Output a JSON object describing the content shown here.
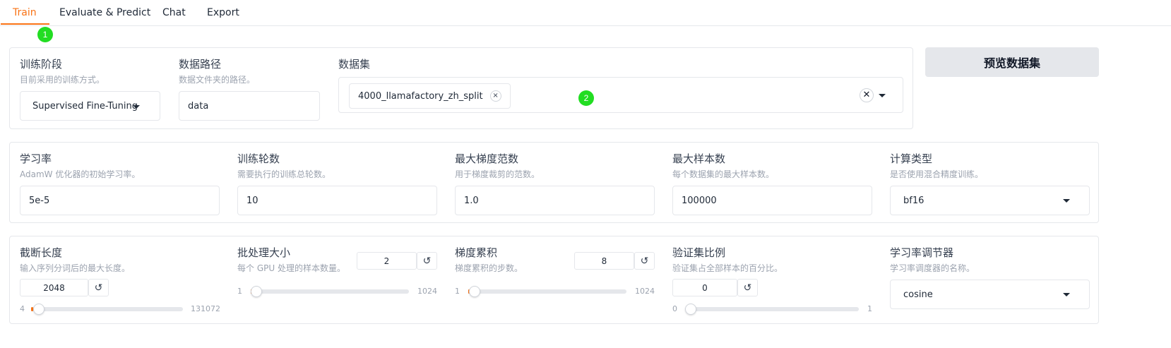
{
  "tabs": [
    {
      "label": "Train",
      "active": true
    },
    {
      "label": "Evaluate & Predict",
      "active": false
    },
    {
      "label": "Chat",
      "active": false
    },
    {
      "label": "Export",
      "active": false
    }
  ],
  "markers": [
    "1",
    "2"
  ],
  "colors": {
    "accent": "#f97316",
    "marker": "#22dd22"
  },
  "row1": {
    "stage": {
      "label": "训练阶段",
      "info": "目前采用的训练方式。",
      "value": "Supervised Fine-Tuning"
    },
    "dataset_dir": {
      "label": "数据路径",
      "info": "数据文件夹的路径。",
      "value": "data"
    },
    "dataset": {
      "label": "数据集",
      "selected": "4000_llamafactory_zh_split",
      "chip_remove": "×",
      "clear": "✕"
    },
    "preview_button": "预览数据集"
  },
  "row2": {
    "learning_rate": {
      "label": "学习率",
      "info": "AdamW 优化器的初始学习率。",
      "value": "5e-5"
    },
    "num_epochs": {
      "label": "训练轮数",
      "info": "需要执行的训练总轮数。",
      "value": "10"
    },
    "max_grad_norm": {
      "label": "最大梯度范数",
      "info": "用于梯度裁剪的范数。",
      "value": "1.0"
    },
    "max_samples": {
      "label": "最大样本数",
      "info": "每个数据集的最大样本数。",
      "value": "100000"
    },
    "compute_type": {
      "label": "计算类型",
      "info": "是否使用混合精度训练。",
      "value": "bf16"
    }
  },
  "row3": {
    "cutoff_len": {
      "label": "截断长度",
      "info": "输入序列分词后的最大长度。",
      "value": "2048",
      "min": "4",
      "max": "131072",
      "fraction": 0.0156
    },
    "batch_size": {
      "label": "批处理大小",
      "info": "每个 GPU 处理的样本数量。",
      "value": "2",
      "min": "1",
      "max": "1024",
      "fraction": 0.001
    },
    "grad_accum": {
      "label": "梯度累积",
      "info": "梯度累积的步数。",
      "value": "8",
      "min": "1",
      "max": "1024",
      "fraction": 0.007
    },
    "val_size": {
      "label": "验证集比例",
      "info": "验证集占全部样本的百分比。",
      "value": "0",
      "min": "0",
      "max": "1",
      "fraction": 0.0
    },
    "lr_scheduler": {
      "label": "学习率调节器",
      "info": "学习率调度器的名称。",
      "value": "cosine"
    },
    "reset_icon": "↺"
  }
}
